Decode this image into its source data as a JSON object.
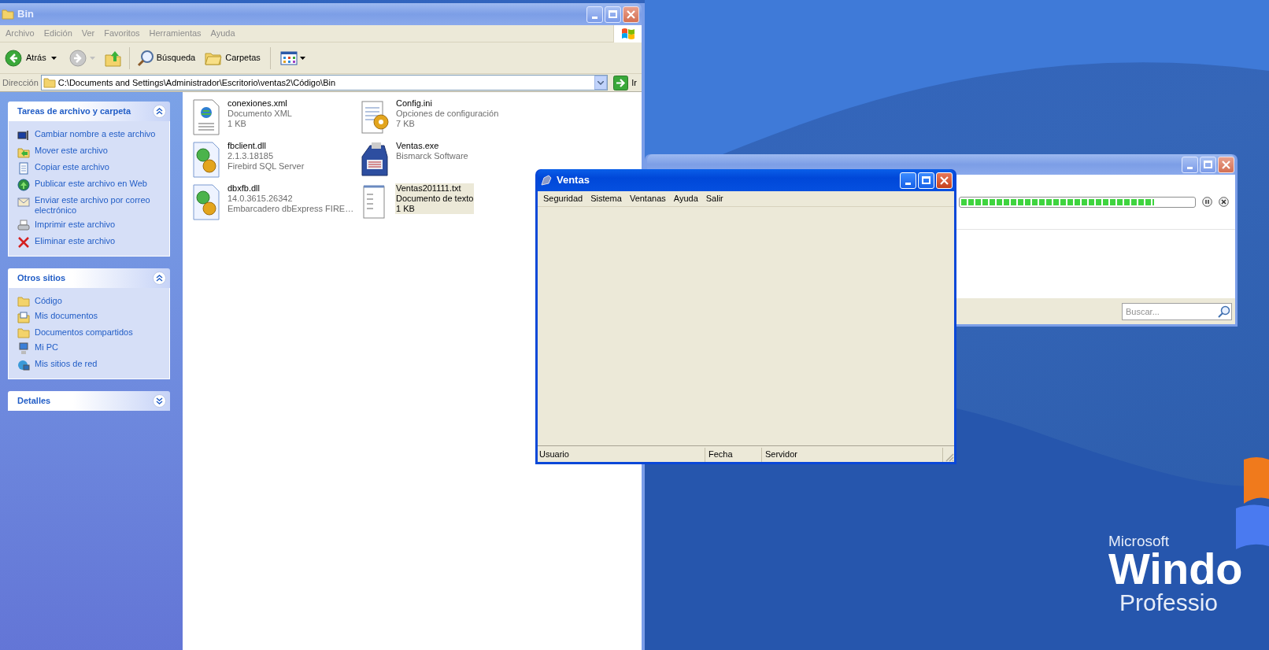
{
  "explorer": {
    "title": "Bin",
    "active": false,
    "menu": [
      "Archivo",
      "Edición",
      "Ver",
      "Favoritos",
      "Herramientas",
      "Ayuda"
    ],
    "toolbar": {
      "back": "Atrás",
      "search": "Búsqueda",
      "folders": "Carpetas"
    },
    "address": {
      "label": "Dirección",
      "value": "C:\\Documents and Settings\\Administrador\\Escritorio\\ventas2\\Código\\Bin",
      "go": "Ir"
    },
    "task_panels": [
      {
        "title": "Tareas de archivo y carpeta",
        "expanded": true,
        "items": [
          {
            "kind": "rename",
            "label": "Cambiar nombre a este archivo"
          },
          {
            "kind": "move",
            "label": "Mover este archivo"
          },
          {
            "kind": "copy",
            "label": "Copiar este archivo"
          },
          {
            "kind": "web",
            "label": "Publicar este archivo en Web"
          },
          {
            "kind": "mail",
            "label": "Enviar este archivo por correo electrónico"
          },
          {
            "kind": "print",
            "label": "Imprimir este archivo"
          },
          {
            "kind": "delete",
            "label": "Eliminar este archivo"
          }
        ]
      },
      {
        "title": "Otros sitios",
        "expanded": true,
        "items": [
          {
            "kind": "folder",
            "label": "Código"
          },
          {
            "kind": "docs",
            "label": "Mis documentos"
          },
          {
            "kind": "folder",
            "label": "Documentos compartidos"
          },
          {
            "kind": "pc",
            "label": "Mi PC"
          },
          {
            "kind": "network",
            "label": "Mis sitios de red"
          }
        ]
      },
      {
        "title": "Detalles",
        "expanded": false
      }
    ],
    "files": [
      {
        "kind": "xml",
        "selected": false,
        "name": "conexiones.xml",
        "details": [
          "Documento XML",
          "1 KB"
        ]
      },
      {
        "kind": "ini",
        "selected": false,
        "name": "Config.ini",
        "details": [
          "Opciones de configuración",
          "7 KB"
        ]
      },
      {
        "kind": "dll",
        "selected": false,
        "name": "fbclient.dll",
        "details": [
          "2.1.3.18185",
          "Firebird SQL Server"
        ]
      },
      {
        "kind": "exe",
        "selected": false,
        "name": "Ventas.exe",
        "details": [
          "Bismarck Software"
        ]
      },
      {
        "kind": "dll",
        "selected": false,
        "name": "dbxfb.dll",
        "details": [
          "14.0.3615.26342",
          "Embarcadero dbExpress FIRE…"
        ]
      },
      {
        "kind": "txt",
        "selected": true,
        "name": "Ventas201111.txt",
        "details": [
          "Documento de texto",
          "1 KB"
        ]
      }
    ]
  },
  "download_window": {
    "active": false,
    "progress": {
      "level": 0.83
    },
    "search": {
      "placeholder": "Buscar..."
    }
  },
  "ventas_window": {
    "title": "Ventas",
    "active": true,
    "menu": [
      "Seguridad",
      "Sistema",
      "Ventanas",
      "Ayuda",
      "Salir"
    ],
    "status_bar": [
      "Usuario",
      "Fecha",
      "Servidor"
    ]
  },
  "wallpaper": {
    "logo_lines": [
      "Microsoft",
      "Windo",
      "Professio"
    ]
  }
}
